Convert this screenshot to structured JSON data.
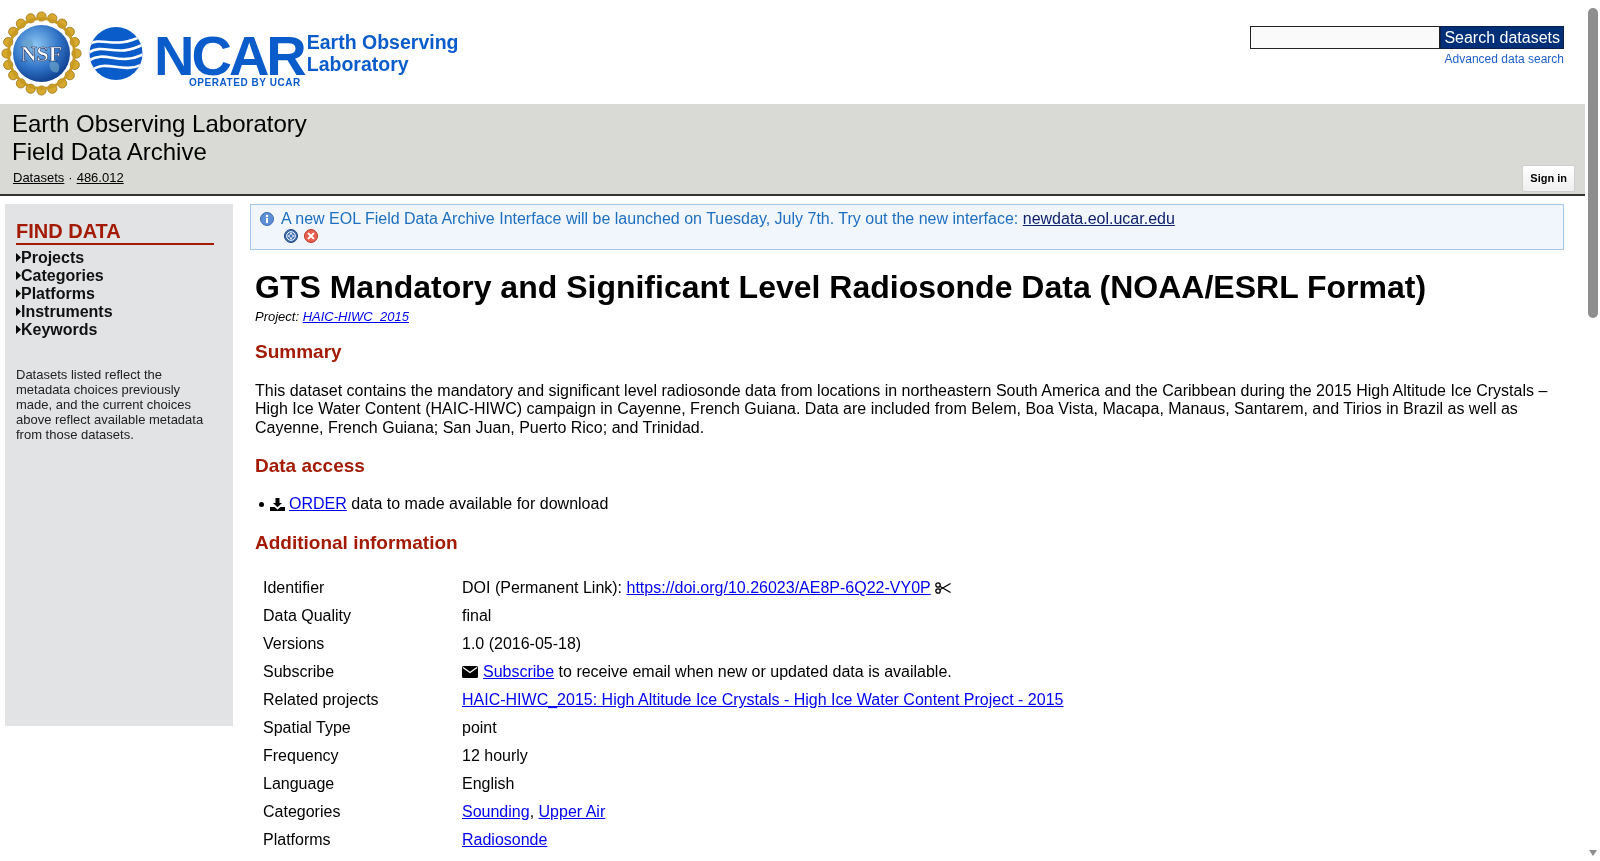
{
  "header": {
    "logo": {
      "emblem_text": "NSF",
      "wordmark": "NCAR",
      "subtitle_lines": [
        "Earth Observing",
        "Laboratory"
      ],
      "tagline": "OPERATED BY UCAR"
    },
    "search": {
      "button": "Search datasets",
      "advanced_link": "Advanced data search"
    }
  },
  "banner": {
    "title_lines": [
      "Earth Observing Laboratory",
      "Field Data Archive"
    ],
    "breadcrumbs": [
      "Datasets",
      "486.012"
    ],
    "separator": "·",
    "sign_in": "Sign in"
  },
  "sidebar": {
    "heading": "FIND DATA",
    "items": [
      {
        "label": "Projects"
      },
      {
        "label": "Categories"
      },
      {
        "label": "Platforms"
      },
      {
        "label": "Instruments"
      },
      {
        "label": "Keywords"
      }
    ],
    "note": "Datasets listed reflect the metadata choices previously made, and the current choices above reflect available metadata from those datasets."
  },
  "notice": {
    "text": "A new EOL Field Data Archive Interface will be launched on Tuesday, July 7th. Try out the new interface:",
    "link": "newdata.eol.ucar.edu"
  },
  "dataset": {
    "title": "GTS Mandatory and Significant Level Radiosonde Data (NOAA/ESRL Format)",
    "project": {
      "label": "Project:",
      "link": "HAIC-HIWC_2015"
    },
    "summary": {
      "heading": "Summary",
      "text": "This dataset contains the mandatory and significant level radiosonde data from locations in northeastern South America and the Caribbean during the 2015 High Altitude Ice Crystals – High Ice Water Content (HAIC-HIWC) campaign in Cayenne, French Guiana. Data are included from Belem, Boa Vista, Macapa, Manaus, Santarem, and Tirios in Brazil as well as Cayenne, French Guiana; San Juan, Puerto Rico; and Trinidad."
    },
    "data_access": {
      "heading": "Data access",
      "items": [
        {
          "link": "ORDER",
          "text": "data to made available for download"
        }
      ]
    },
    "additional_info": {
      "heading": "Additional information",
      "rows": [
        {
          "label": "Identifier",
          "kind": "doi",
          "text": "DOI (Permanent Link):",
          "link": "https://doi.org/10.26023/AE8P-6Q22-VY0P"
        },
        {
          "label": "Data Quality",
          "kind": "text",
          "value": "final"
        },
        {
          "label": "Versions",
          "kind": "text",
          "value": "1.0 (2016-05-18)"
        },
        {
          "label": "Subscribe",
          "kind": "subscribe",
          "link": "Subscribe",
          "text": "to receive email when new or updated data is available."
        },
        {
          "label": "Related projects",
          "kind": "links",
          "links": [
            "HAIC-HIWC_2015: High Altitude Ice Crystals - High Ice Water Content Project - 2015"
          ]
        },
        {
          "label": "Spatial Type",
          "kind": "text",
          "value": "point"
        },
        {
          "label": "Frequency",
          "kind": "text",
          "value": "12 hourly"
        },
        {
          "label": "Language",
          "kind": "text",
          "value": "English"
        },
        {
          "label": "Categories",
          "kind": "links",
          "links": [
            "Sounding",
            "Upper Air"
          ],
          "separator": ","
        },
        {
          "label": "Platforms",
          "kind": "links",
          "links": [
            "Radiosonde"
          ]
        }
      ]
    }
  }
}
